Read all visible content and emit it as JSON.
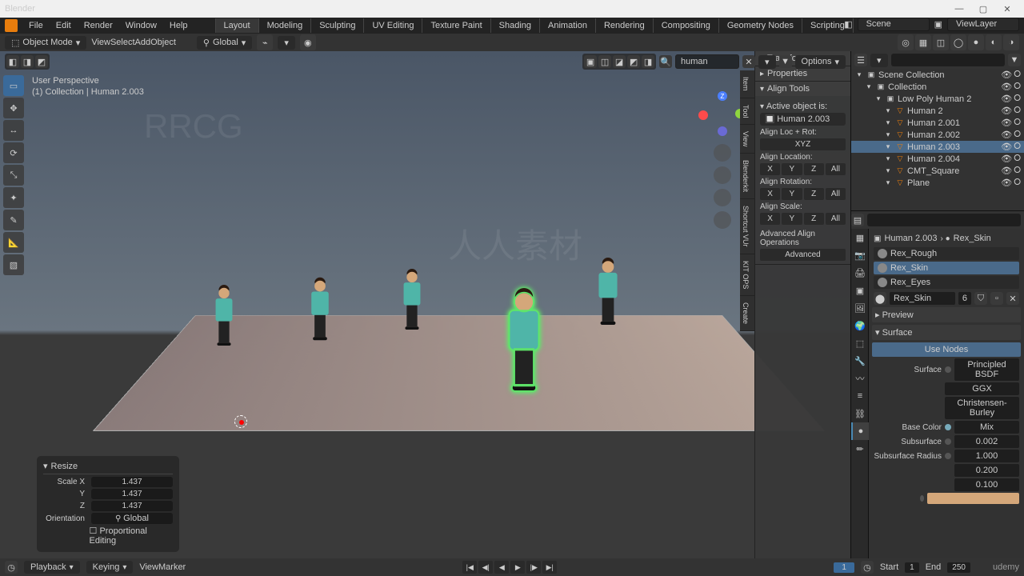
{
  "titlebar": {
    "app": "Blender"
  },
  "menus": [
    "File",
    "Edit",
    "Render",
    "Window",
    "Help"
  ],
  "workspaces": [
    "Layout",
    "Modeling",
    "Sculpting",
    "UV Editing",
    "Texture Paint",
    "Shading",
    "Animation",
    "Rendering",
    "Compositing",
    "Geometry Nodes",
    "Scripting"
  ],
  "active_workspace": "Layout",
  "scene_field": "Scene",
  "viewlayer_field": "ViewLayer",
  "header2": {
    "mode": "Object Mode",
    "menus": [
      "View",
      "Select",
      "Add",
      "Object"
    ],
    "orientation": "Global"
  },
  "vp_header": {
    "search": "human",
    "options": "Options"
  },
  "vp_info": {
    "l1": "User Perspective",
    "l2": "(1) Collection | Human 2.003"
  },
  "npanel": {
    "sections": {
      "transform": "Transform",
      "properties": "Properties",
      "align": "Align Tools"
    },
    "active_obj_lbl": "Active object is:",
    "active_obj": "Human 2.003",
    "align_locrot": "Align Loc + Rot:",
    "xyz": "XYZ",
    "align_loc": "Align Location:",
    "align_rot": "Align Rotation:",
    "align_scale": "Align Scale:",
    "axes": [
      "X",
      "Y",
      "Z",
      "All"
    ],
    "adv_ops": "Advanced Align Operations",
    "advanced": "Advanced",
    "tabs": [
      "Item",
      "Tool",
      "View",
      "Blenderkit",
      "Shortcut VUr",
      "KIT OPS",
      "Create"
    ]
  },
  "resize": {
    "title": "Resize",
    "scale_x": "Scale X",
    "y": "Y",
    "z": "Z",
    "val": "1.437",
    "orientation_lbl": "Orientation",
    "orientation": "Global",
    "prop_edit": "Proportional Editing"
  },
  "outliner": {
    "root": "Scene Collection",
    "collection": "Collection",
    "group": "Low Poly Human 2",
    "items": [
      "Human 2",
      "Human 2.001",
      "Human 2.002",
      "Human 2.003",
      "Human 2.004",
      "CMT_Square",
      "Plane"
    ],
    "selected": "Human 2.003"
  },
  "props": {
    "crumb_obj": "Human 2.003",
    "crumb_mat": "Rex_Skin",
    "materials": [
      "Rex_Rough",
      "Rex_Skin",
      "Rex_Eyes"
    ],
    "selected_mat": "Rex_Skin",
    "mat_field": "Rex_Skin",
    "mat_users": "6",
    "preview": "Preview",
    "surface": "Surface",
    "use_nodes": "Use Nodes",
    "surface_lbl": "Surface",
    "surface_val": "Principled BSDF",
    "dist": "GGX",
    "sss_method": "Christensen-Burley",
    "base_color_lbl": "Base Color",
    "base_color_val": "Mix",
    "subsurface_lbl": "Subsurface",
    "subsurface_val": "0.002",
    "radius_lbl": "Subsurface Radius",
    "radius": [
      "1.000",
      "0.200",
      "0.100"
    ]
  },
  "timeline": {
    "playback": "Playback",
    "keying": "Keying",
    "menus": [
      "View",
      "Marker"
    ],
    "cur": "1",
    "start_lbl": "Start",
    "start": "1",
    "end_lbl": "End",
    "end": "250"
  },
  "udemy": "udemy"
}
